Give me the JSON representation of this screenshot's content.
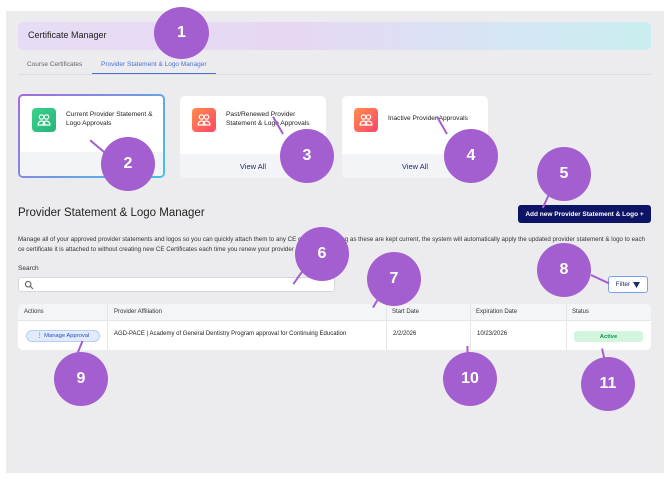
{
  "header": {
    "title": "Certificate Manager"
  },
  "tabs": [
    {
      "label": "Course Certificates"
    },
    {
      "label": "Provider Statement & Logo Manager"
    }
  ],
  "cards": [
    {
      "label": "Current Provider Statement & Logo Approvals",
      "footer": ""
    },
    {
      "label": "Past/Renewed Provider Statement & Logo Approvals",
      "footer": "View All"
    },
    {
      "label": "Inactive Provider Approvals",
      "footer": "View All"
    }
  ],
  "section": {
    "title": "Provider Statement & Logo Manager",
    "add_button": "Add new Provider Statement & Logo  +",
    "description": "Manage all of your approved provider statements and logos so you can quickly attach them to any CE certificate. As long as these are kept current, the system will automatically apply the updated provider statement & logo to each ce certificate it is attached to without creating new CE Certificates each time you renew your provider approval."
  },
  "search": {
    "label": "Search",
    "placeholder": ""
  },
  "filter": {
    "label": "Filter"
  },
  "table": {
    "headers": [
      "Actions",
      "Provider Affiliation",
      "Start Date",
      "Expiration Date",
      "Status"
    ],
    "rows": [
      {
        "action": "⋮  Manage Approval",
        "affiliation": "AGD-PACE | Academy of General Dentistry Program approval for Continuing Education",
        "start": "2/2/2026",
        "expiration": "10/23/2026",
        "status": "Active"
      }
    ]
  },
  "annotations": [
    "1",
    "2",
    "3",
    "4",
    "5",
    "6",
    "7",
    "8",
    "9",
    "10",
    "11"
  ],
  "colors": {
    "primary": "#0d1466",
    "accent": "#4a72d6",
    "annotation": "#a35fcf",
    "status_active": "#1a8f47"
  }
}
